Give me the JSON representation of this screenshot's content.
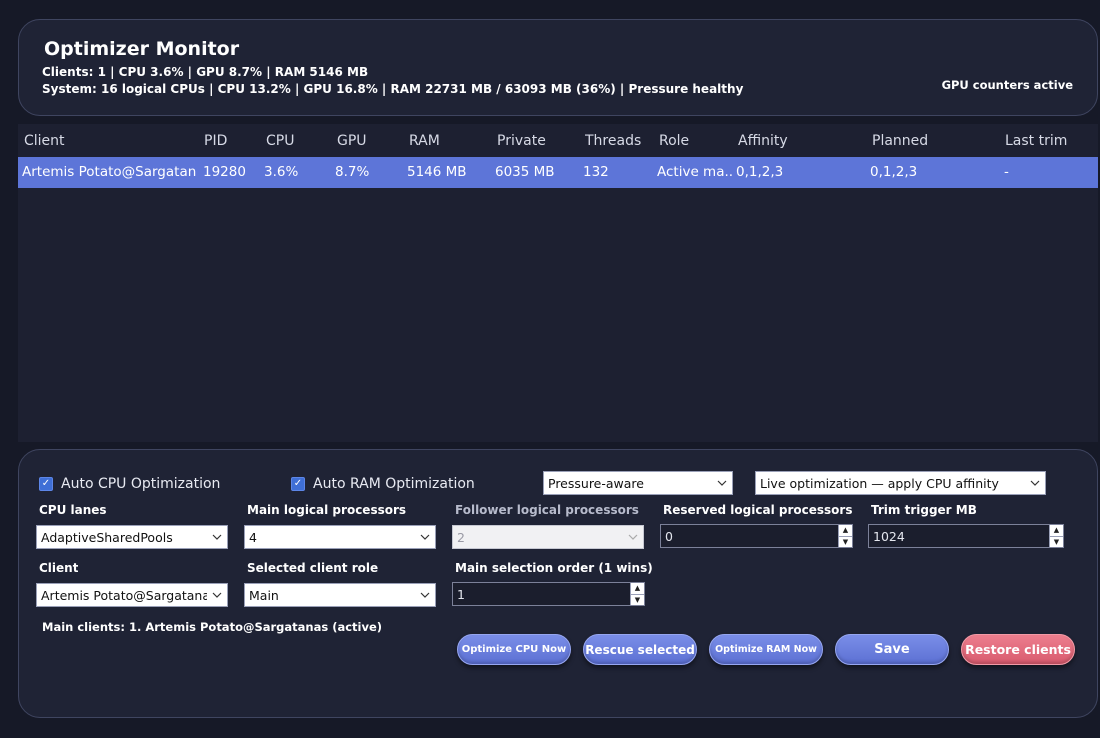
{
  "header": {
    "title": "Optimizer Monitor",
    "clients_line": "Clients: 1 | CPU 3.6% | GPU 8.7% | RAM 5146 MB",
    "system_line": "System: 16 logical CPUs | CPU 13.2% | GPU 16.8% | RAM 22731 MB / 63093 MB (36%) | Pressure healthy",
    "gpu_status": "GPU counters active"
  },
  "table": {
    "columns": [
      "Client",
      "PID",
      "CPU",
      "GPU",
      "RAM",
      "Private",
      "Threads",
      "Role",
      "Affinity",
      "Planned",
      "Last trim"
    ],
    "rows": [
      [
        "Artemis Potato@Sargatanas",
        "19280",
        "3.6%",
        "8.7%",
        "5146 MB",
        "6035 MB",
        "132",
        "Active ma...",
        "0,1,2,3",
        "0,1,2,3",
        "-"
      ]
    ]
  },
  "controls": {
    "auto_cpu_label": "Auto CPU Optimization",
    "auto_ram_label": "Auto RAM Optimization",
    "pressure_mode": "Pressure-aware",
    "live_mode": "Live optimization — apply CPU affinity",
    "cpu_lanes_label": "CPU lanes",
    "cpu_lanes_value": "AdaptiveSharedPools",
    "main_lp_label": "Main logical processors",
    "main_lp_value": "4",
    "follower_lp_label": "Follower logical processors (Split",
    "follower_lp_value": "2",
    "reserved_lp_label": "Reserved logical processors",
    "reserved_lp_value": "0",
    "trim_label": "Trim trigger MB",
    "trim_value": "1024",
    "client_label": "Client",
    "client_value": "Artemis Potato@Sargatanas",
    "role_label": "Selected client role",
    "role_value": "Main",
    "order_label": "Main selection order (1 wins)",
    "order_value": "1",
    "main_clients": "Main clients: 1. Artemis Potato@Sargatanas (active)"
  },
  "buttons": {
    "optimize_cpu": "Optimize CPU Now",
    "rescue": "Rescue selected",
    "optimize_ram": "Optimize RAM Now",
    "save": "Save",
    "restore": "Restore clients"
  },
  "colors": {
    "background": "#161927",
    "panel": "#1f2335",
    "selection": "#5d75d8",
    "button_blue": "#6b7fdf",
    "button_red": "#e06b7c",
    "checkbox": "#3f6fd6"
  },
  "icons": {
    "dropdown": "chevron-down-icon",
    "spinner": "spin-arrows-icon",
    "checkbox": "checkmark-icon"
  }
}
